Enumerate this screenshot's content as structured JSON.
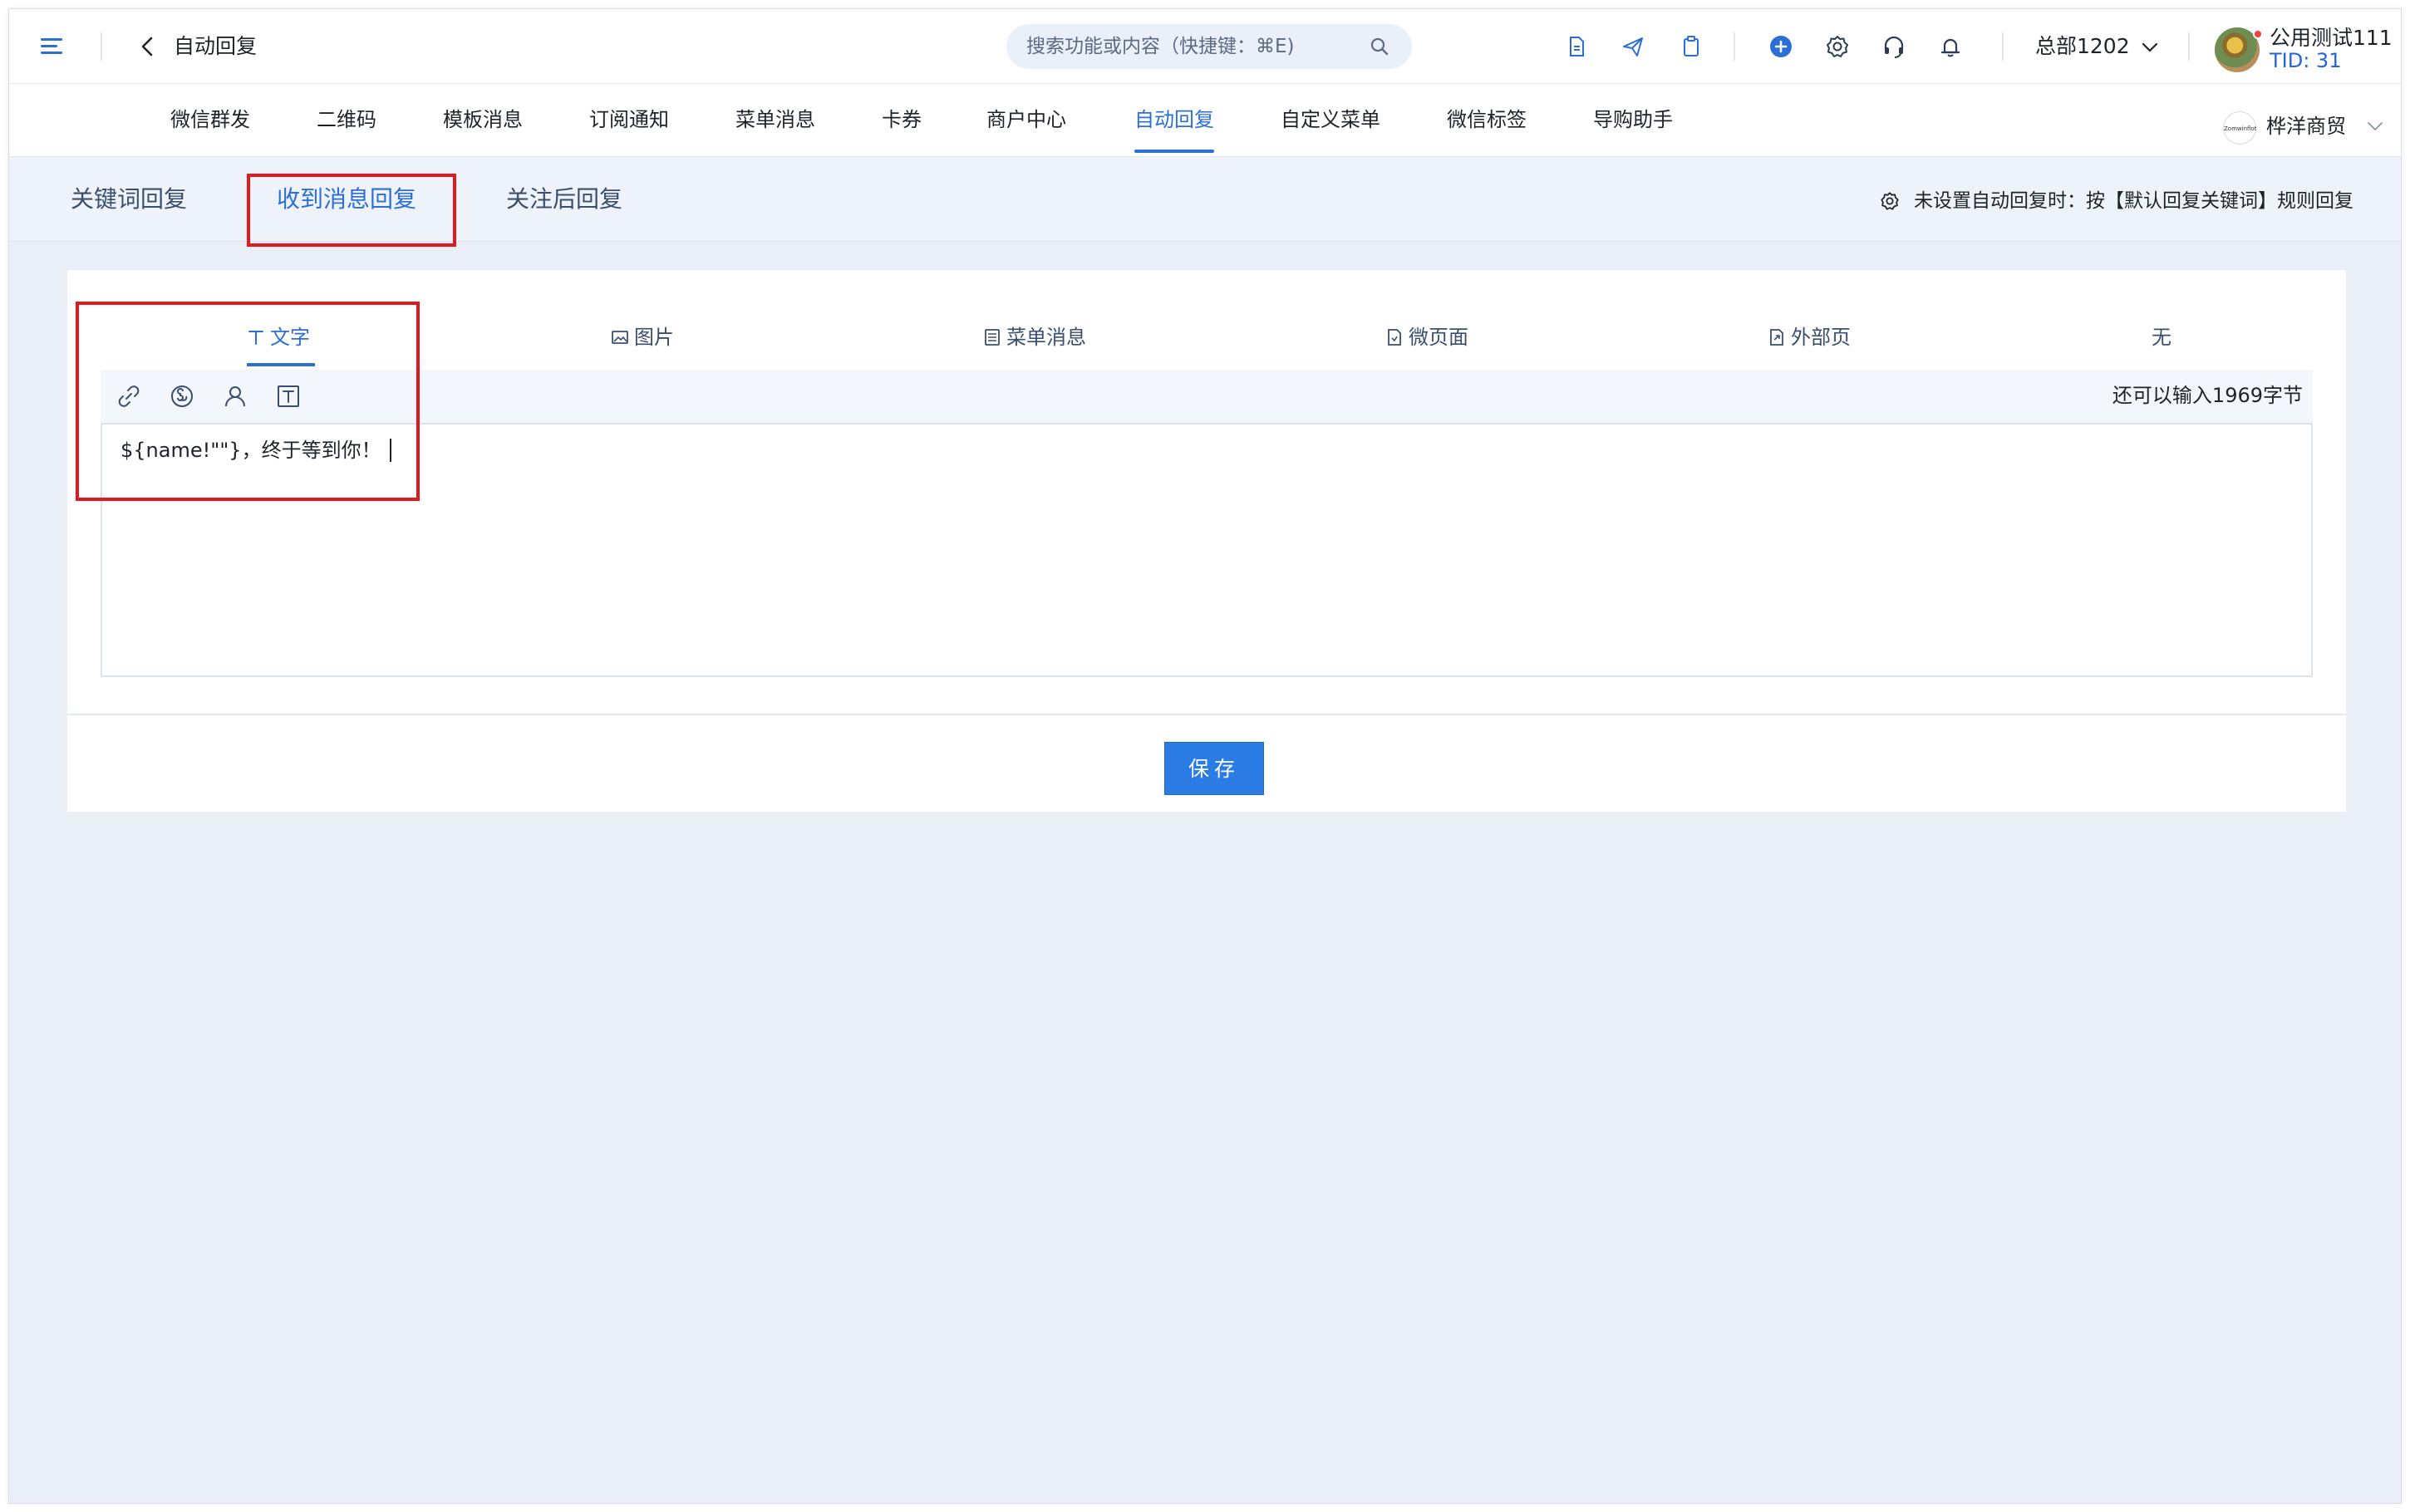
{
  "header": {
    "page_title": "自动回复",
    "search_placeholder": "搜索功能或内容（快捷键：⌘E)",
    "org_label": "总部1202",
    "user_name": "公用测试111",
    "user_tid": "TID: 31",
    "icons": [
      "document-icon",
      "send-icon",
      "clipboard-icon",
      "add-circle-icon",
      "settings-icon",
      "headset-icon",
      "bell-icon"
    ]
  },
  "nav": {
    "items": [
      {
        "label": "微信群发"
      },
      {
        "label": "二维码"
      },
      {
        "label": "模板消息"
      },
      {
        "label": "订阅通知"
      },
      {
        "label": "菜单消息"
      },
      {
        "label": "卡券"
      },
      {
        "label": "商户中心"
      },
      {
        "label": "自动回复"
      },
      {
        "label": "自定义菜单"
      },
      {
        "label": "微信标签"
      },
      {
        "label": "导购助手"
      }
    ],
    "active": "自动回复",
    "brand_logo_text": "Zomwinflot",
    "brand_name": "桦洋商贸"
  },
  "subtabs": {
    "items": [
      {
        "label": "关键词回复"
      },
      {
        "label": "收到消息回复"
      },
      {
        "label": "关注后回复"
      }
    ],
    "active": "收到消息回复",
    "hint": "未设置自动回复时：按【默认回复关键词】规则回复"
  },
  "reply": {
    "types": [
      {
        "label": "文字",
        "icon": "text-icon"
      },
      {
        "label": "图片",
        "icon": "image-icon"
      },
      {
        "label": "菜单消息",
        "icon": "list-icon"
      },
      {
        "label": "微页面",
        "icon": "page-icon"
      },
      {
        "label": "外部页",
        "icon": "external-page-icon"
      },
      {
        "label": "无",
        "icon": ""
      }
    ],
    "active_type": "文字",
    "toolbar_icons": [
      "link-icon",
      "mini-program-icon",
      "user-icon",
      "text-format-icon"
    ],
    "remaining_text": "还可以输入1969字节",
    "editor_content": "${name!\"\"}，终于等到你！",
    "save_label": "保存"
  },
  "colors": {
    "accent": "#2b6fd6",
    "highlight_box": "#e0191f",
    "page_bg": "#e9eef7"
  }
}
